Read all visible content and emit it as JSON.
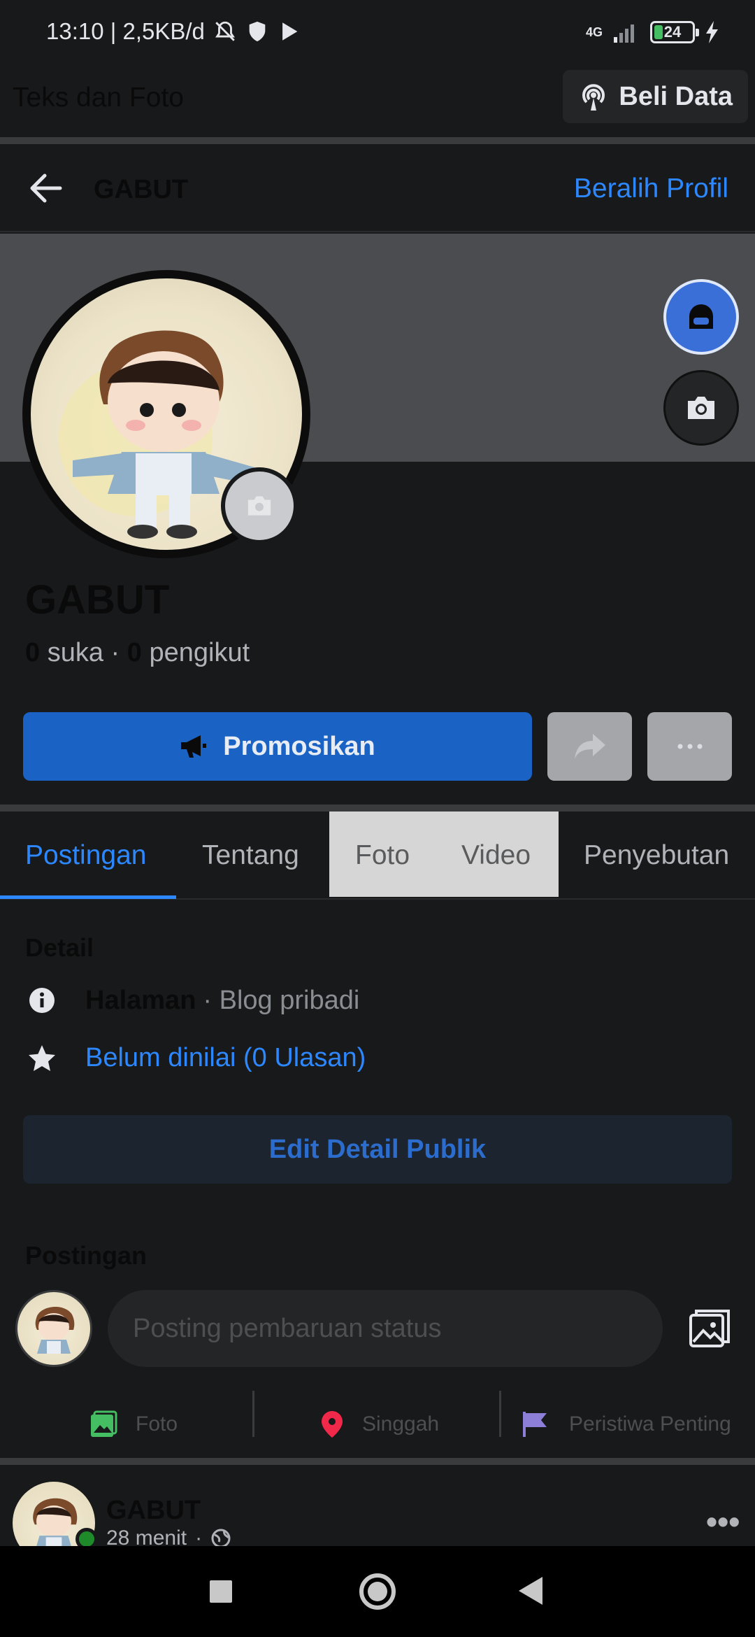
{
  "status_bar": {
    "time_speed": "13:10 | 2,5KB/d",
    "network": "4G",
    "battery": "24"
  },
  "banner": {
    "label": "Teks dan Foto",
    "buy_data": "Beli Data"
  },
  "nav": {
    "title": "GABUT",
    "switch_profile": "Beralih Profil"
  },
  "profile": {
    "name": "GABUT",
    "likes_count": "0",
    "likes_label": "suka",
    "followers_count": "0",
    "followers_label": "pengikut"
  },
  "buttons": {
    "promote": "Promosikan"
  },
  "tabs": [
    {
      "label": "Postingan",
      "active": true
    },
    {
      "label": "Tentang"
    },
    {
      "label": "Foto"
    },
    {
      "label": "Video"
    },
    {
      "label": "Penyebutan"
    }
  ],
  "detail": {
    "heading": "Detail",
    "page_type_strong": "Halaman",
    "page_type_rest": "· Blog pribadi",
    "rating": "Belum dinilai (0 Ulasan)",
    "edit_button": "Edit Detail Publik"
  },
  "posts": {
    "heading": "Postingan",
    "status_placeholder": "Posting pembaruan status",
    "actions": [
      {
        "label": "Foto",
        "icon": "photo-icon"
      },
      {
        "label": "Singgah",
        "icon": "location-pin-icon"
      },
      {
        "label": "Peristiwa Penting",
        "icon": "flag-icon"
      }
    ]
  },
  "feed": {
    "name": "GABUT",
    "time": "28 menit",
    "separator": "·"
  },
  "colors": {
    "background": "#18191a",
    "accent_blue": "#2d88ff",
    "promote_blue": "#1b62c5"
  }
}
